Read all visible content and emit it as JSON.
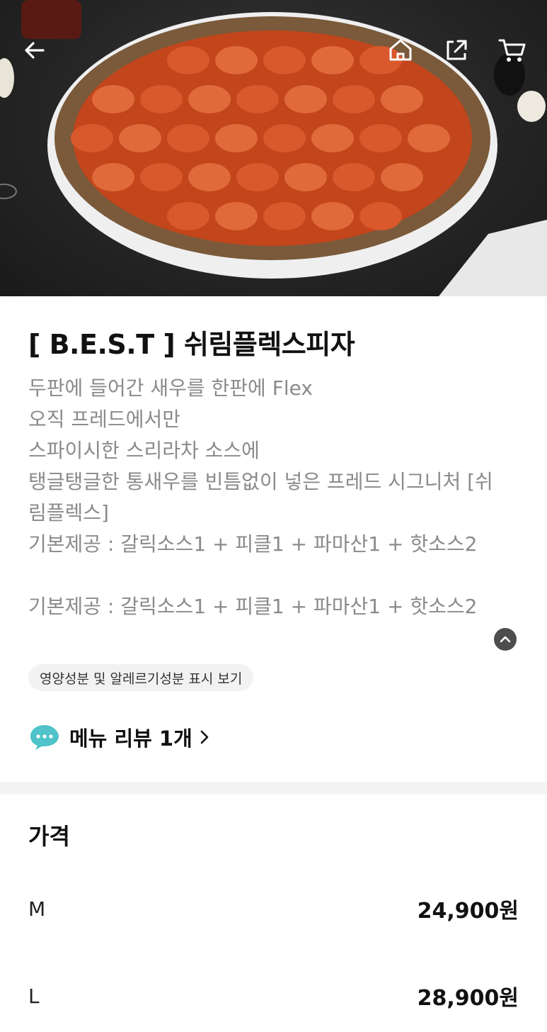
{
  "header": {
    "back_icon": "arrow-left-icon",
    "home_icon": "home-icon",
    "share_icon": "share-icon",
    "cart_icon": "cart-icon"
  },
  "product": {
    "title": "[ B.E.S.T ] 쉬림플렉스피자",
    "description_lines": [
      "두판에 들어간 새우를 한판에 Flex",
      "오직 프레드에서만",
      "스파이시한 스리라차 소스에",
      "탱글탱글한 통새우를 빈틈없이 넣은 프레드 시그니처 [쉬",
      "림플렉스]",
      "기본제공 : 갈릭소스1 + 피클1 + 파마산1 + 핫소스2",
      "",
      "기본제공 : 갈릭소스1 + 피클1 + 파마산1 + 핫소스2"
    ],
    "nutrition_link": "영양성분 및 알레르기성분 표시 보기",
    "review_label": "메뉴 리뷰 1개"
  },
  "price": {
    "title": "가격",
    "options": [
      {
        "size": "M",
        "amount": "24,900원"
      },
      {
        "size": "L",
        "amount": "28,900원"
      }
    ]
  },
  "colors": {
    "review_bubble": "#4fc3c9",
    "description_text": "#8a8a8a"
  }
}
